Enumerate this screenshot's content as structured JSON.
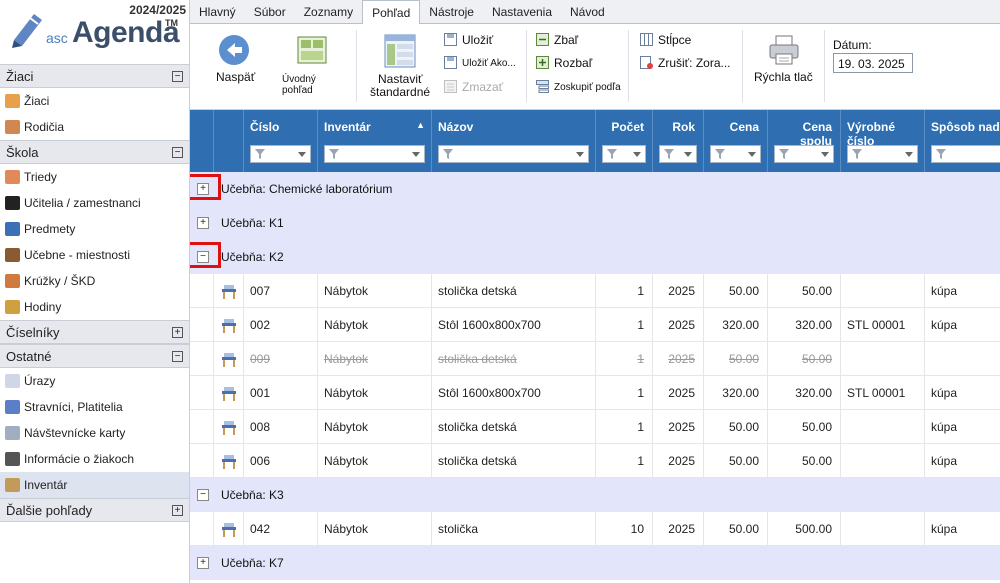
{
  "app": {
    "year": "2024/2025",
    "logo_asc": "asc",
    "logo_agenda": "Agenda",
    "logo_tm": "TM"
  },
  "sidebar": {
    "sections": [
      {
        "title": "Žiaci",
        "toggle": "−",
        "items": [
          {
            "label": "Žiaci",
            "icon": "student-icon",
            "color": "#e8a04a"
          },
          {
            "label": "Rodičia",
            "icon": "parents-icon",
            "color": "#d08850"
          }
        ]
      },
      {
        "title": "Škola",
        "toggle": "−",
        "items": [
          {
            "label": "Triedy",
            "icon": "class-icon",
            "color": "#e08a5a"
          },
          {
            "label": "Učitelia / zamestnanci",
            "icon": "teacher-icon",
            "color": "#222222"
          },
          {
            "label": "Predmety",
            "icon": "subject-icon",
            "color": "#3b6fb6"
          },
          {
            "label": "Učebne - miestnosti",
            "icon": "room-icon",
            "color": "#8a5a30"
          },
          {
            "label": "Krúžky / ŠKD",
            "icon": "club-icon",
            "color": "#d07a40"
          },
          {
            "label": "Hodiny",
            "icon": "lessons-icon",
            "color": "#d0a040"
          }
        ]
      },
      {
        "title": "Číselníky",
        "toggle": "+",
        "items": []
      },
      {
        "title": "Ostatné",
        "toggle": "−",
        "items": [
          {
            "label": "Úrazy",
            "icon": "injury-icon",
            "color": "#cfd6e6"
          },
          {
            "label": "Stravníci, Platitelia",
            "icon": "diner-icon",
            "color": "#5a7fc8"
          },
          {
            "label": "Návštevnícke karty",
            "icon": "visitor-card-icon",
            "color": "#a0aebf"
          },
          {
            "label": "Informácie o žiakoch",
            "icon": "student-info-icon",
            "color": "#555555"
          },
          {
            "label": "Inventár",
            "icon": "inventory-icon",
            "color": "#c49a5a"
          }
        ]
      },
      {
        "title": "Ďalšie pohľady",
        "toggle": "+",
        "items": []
      }
    ]
  },
  "tabs": [
    "Hlavný",
    "Súbor",
    "Zoznamy",
    "Pohľad",
    "Nástroje",
    "Nastavenia",
    "Návod"
  ],
  "active_tab": "Pohľad",
  "ribbon": {
    "back": "Naspäť",
    "home_view": "Úvodný pohľad",
    "set_default_1": "Nastaviť",
    "set_default_2": "štandardné",
    "save": "Uložiť",
    "save_as": "Uložiť Ako...",
    "delete": "Zmazať",
    "collapse": "Zbaľ",
    "expand": "Rozbaľ",
    "group_by": "Zoskupiť podľa",
    "columns": "Stĺpce",
    "cancel_sort": "Zrušiť: Zora...",
    "quick_print": "Rýchla tlač",
    "date_label": "Dátum:",
    "date_value": "19. 03. 2025"
  },
  "grid": {
    "columns": [
      "Číslo",
      "Inventár",
      "Názov",
      "Počet",
      "Rok",
      "Cena",
      "Cena spolu",
      "Výrobné číslo",
      "Spôsob nad"
    ],
    "groups": [
      {
        "label": "Učebňa: Chemické laboratórium",
        "toggle": "+",
        "highlighted": true,
        "rows": []
      },
      {
        "label": "Učebňa: K1",
        "toggle": "+",
        "highlighted": false,
        "rows": []
      },
      {
        "label": "Učebňa: K2",
        "toggle": "−",
        "highlighted": true,
        "rows": [
          {
            "cislo": "007",
            "inventar": "Nábytok",
            "nazov": "stolička detská",
            "pocet": "1",
            "rok": "2025",
            "cena": "50.00",
            "spolu": "50.00",
            "vyrobne": "",
            "sposob": "kúpa",
            "struck": false
          },
          {
            "cislo": "002",
            "inventar": "Nábytok",
            "nazov": "Stôl 1600x800x700",
            "pocet": "1",
            "rok": "2025",
            "cena": "320.00",
            "spolu": "320.00",
            "vyrobne": "STL 00001",
            "sposob": "kúpa",
            "struck": false
          },
          {
            "cislo": "009",
            "inventar": "Nábytok",
            "nazov": "stolička detská",
            "pocet": "1",
            "rok": "2025",
            "cena": "50.00",
            "spolu": "50.00",
            "vyrobne": "",
            "sposob": "",
            "struck": true
          },
          {
            "cislo": "001",
            "inventar": "Nábytok",
            "nazov": "Stôl 1600x800x700",
            "pocet": "1",
            "rok": "2025",
            "cena": "320.00",
            "spolu": "320.00",
            "vyrobne": "STL 00001",
            "sposob": "kúpa",
            "struck": false
          },
          {
            "cislo": "008",
            "inventar": "Nábytok",
            "nazov": "stolička detská",
            "pocet": "1",
            "rok": "2025",
            "cena": "50.00",
            "spolu": "50.00",
            "vyrobne": "",
            "sposob": "kúpa",
            "struck": false
          },
          {
            "cislo": "006",
            "inventar": "Nábytok",
            "nazov": "stolička detská",
            "pocet": "1",
            "rok": "2025",
            "cena": "50.00",
            "spolu": "50.00",
            "vyrobne": "",
            "sposob": "kúpa",
            "struck": false
          }
        ]
      },
      {
        "label": "Učebňa: K3",
        "toggle": "−",
        "highlighted": false,
        "rows": [
          {
            "cislo": "042",
            "inventar": "Nábytok",
            "nazov": "stolička",
            "pocet": "10",
            "rok": "2025",
            "cena": "50.00",
            "spolu": "500.00",
            "vyrobne": "",
            "sposob": "kúpa",
            "struck": false
          }
        ]
      },
      {
        "label": "Učebňa: K7",
        "toggle": "+",
        "highlighted": false,
        "rows": []
      }
    ]
  }
}
